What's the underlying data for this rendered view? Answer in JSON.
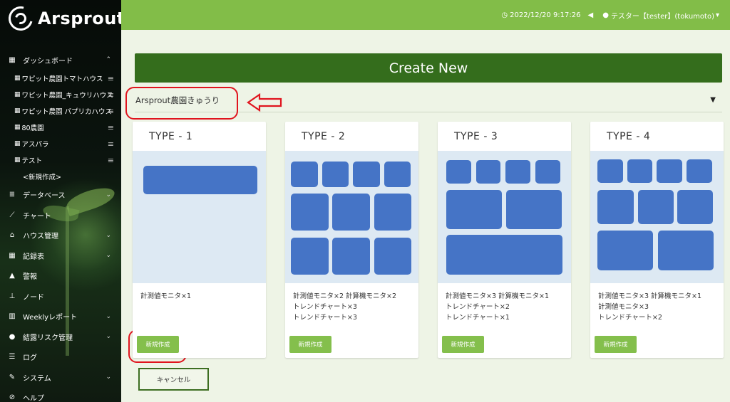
{
  "app": {
    "logo_text": "Arsprout"
  },
  "header": {
    "datetime": "2022/12/20 9:17:26",
    "user": "テスター【tester】(tokumoto)",
    "icons": [
      "clock-icon",
      "megaphone-icon",
      "user-icon",
      "caret-down-icon"
    ]
  },
  "sidebar": {
    "items": [
      {
        "label": "ダッシュボード",
        "icon": "dashboard-icon",
        "chevron": "up"
      },
      {
        "label": "ワピット農園トマトハウス",
        "sub": true
      },
      {
        "label": "ワピット農園_キュウリハウス",
        "sub": true
      },
      {
        "label": "ワピット農園 パプリカハウス",
        "sub": true
      },
      {
        "label": "80農園",
        "sub": true
      },
      {
        "label": "アスパラ",
        "sub": true
      },
      {
        "label": "テスト",
        "sub": true
      },
      {
        "label": "<新規作成>",
        "sub": true
      },
      {
        "label": "データベース",
        "icon": "database-icon",
        "chevron": "down"
      },
      {
        "label": "チャート",
        "icon": "chart-icon"
      },
      {
        "label": "ハウス管理",
        "icon": "house-icon",
        "chevron": "down"
      },
      {
        "label": "記録表",
        "icon": "table-icon",
        "chevron": "down"
      },
      {
        "label": "警報",
        "icon": "bell-icon"
      },
      {
        "label": "ノード",
        "icon": "sitemap-icon"
      },
      {
        "label": "Weeklyレポート",
        "icon": "bar-chart-icon",
        "chevron": "down"
      },
      {
        "label": "結露リスク管理",
        "icon": "droplet-icon",
        "chevron": "down"
      },
      {
        "label": "ログ",
        "icon": "list-icon"
      },
      {
        "label": "システム",
        "icon": "wrench-icon",
        "chevron": "down"
      },
      {
        "label": "ヘルプ",
        "icon": "help-icon"
      }
    ]
  },
  "main": {
    "create_new_title": "Create New",
    "house_select": {
      "value": "Arsprout農園きゅうり"
    },
    "cards": [
      {
        "title": "TYPE - 1",
        "desc": [
          "計測値モニタ×1"
        ],
        "button": "新規作成"
      },
      {
        "title": "TYPE - 2",
        "desc": [
          "計測値モニタ×2 計算機モニタ×2",
          "トレンドチャート×3",
          "トレンドチャート×3"
        ],
        "button": "新規作成"
      },
      {
        "title": "TYPE - 3",
        "desc": [
          "計測値モニタ×3 計算機モニタ×1",
          "トレンドチャート×2",
          "トレンドチャート×1"
        ],
        "button": "新規作成"
      },
      {
        "title": "TYPE - 4",
        "desc": [
          "計測値モニタ×3 計算機モニタ×1",
          "計測値モニタ×3",
          "トレンドチャート×2"
        ],
        "button": "新規作成"
      }
    ],
    "cancel_label": "キャンセル"
  },
  "colors": {
    "header_bg": "#82bd48",
    "create_new_bg": "#346d1c",
    "preview_bg": "#dde9f3",
    "block": "#4574c6",
    "button": "#84bf4c",
    "annotation": "#e0141e"
  }
}
